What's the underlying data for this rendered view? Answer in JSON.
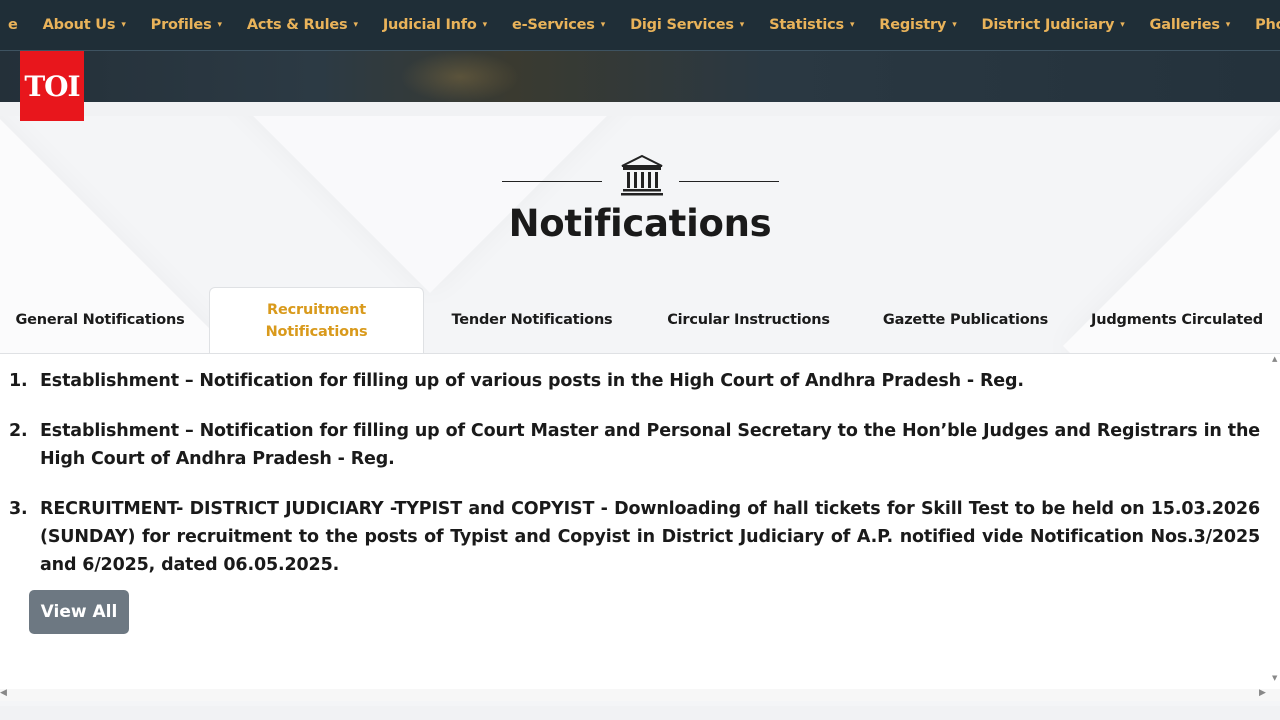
{
  "nav": {
    "items": [
      {
        "label": "e",
        "caret": ""
      },
      {
        "label": "About Us",
        "caret": "▾"
      },
      {
        "label": "Profiles",
        "caret": "▾"
      },
      {
        "label": "Acts & Rules",
        "caret": "▾"
      },
      {
        "label": "Judicial Info",
        "caret": "▾"
      },
      {
        "label": "e-Services",
        "caret": "▾"
      },
      {
        "label": "Digi Services",
        "caret": "▾"
      },
      {
        "label": "Statistics",
        "caret": "▾"
      },
      {
        "label": "Registry",
        "caret": "▾"
      },
      {
        "label": "District Judiciary",
        "caret": "▾"
      },
      {
        "label": "Galleries",
        "caret": "▾"
      },
      {
        "label": "Phone Director",
        "caret": ""
      }
    ]
  },
  "logo": {
    "text": "TOI"
  },
  "section": {
    "title": "Notifications",
    "icon": "courthouse-icon"
  },
  "tabs": [
    {
      "label": "General Notifications",
      "active": false
    },
    {
      "label": "Recruitment Notifications",
      "line1": "Recruitment",
      "line2": "Notifications",
      "active": true
    },
    {
      "label": "Tender Notifications",
      "active": false
    },
    {
      "label": "Circular Instructions",
      "active": false
    },
    {
      "label": "Gazette Publications",
      "active": false
    },
    {
      "label": "Judgments Circulated",
      "active": false
    }
  ],
  "notices": [
    {
      "num": "1.",
      "text": "Establishment – Notification for filling up of various posts in the High Court of Andhra Pradesh - Reg."
    },
    {
      "num": "2.",
      "text": "Establishment – Notification for filling up of Court Master and Personal Secretary to the Hon’ble Judges and Registrars in the High Court of Andhra Pradesh - Reg."
    },
    {
      "num": "3.",
      "text": "RECRUITMENT- DISTRICT JUDICIARY -TYPIST and COPYIST - Downloading of hall tickets for Skill Test to be held on 15.03.2026 (SUNDAY) for recruitment to the posts of Typist and Copyist in District Judiciary of A.P. notified vide Notification Nos.3/2025 and 6/2025, dated 06.05.2025."
    }
  ],
  "view_all_label": "View All",
  "scroll": {
    "up": "▲",
    "down": "▼",
    "left": "◀",
    "right": "▶"
  },
  "colors": {
    "nav_bg": "#1f2e37",
    "nav_text": "#e9b35a",
    "active_tab": "#d99a1c",
    "logo_bg": "#e8161c",
    "button_bg": "#6d7882"
  }
}
